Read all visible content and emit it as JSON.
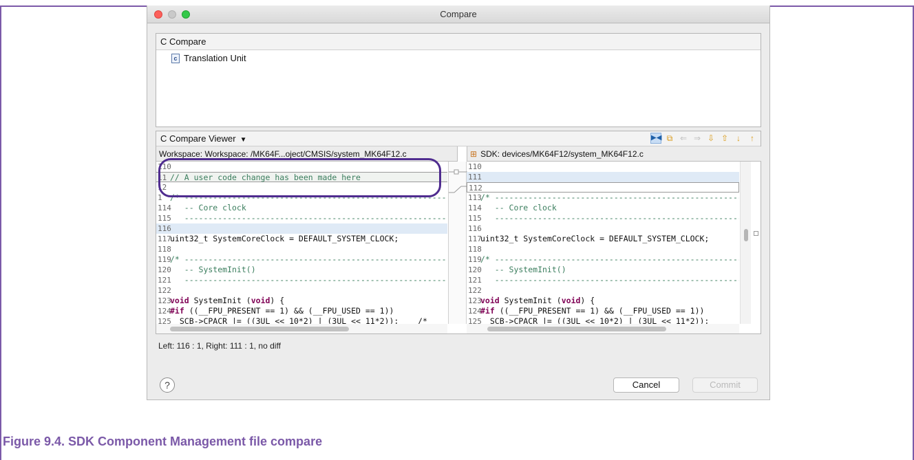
{
  "window": {
    "title": "Compare"
  },
  "structure": {
    "header": "C Compare",
    "item": "Translation Unit",
    "item_icon": "c-file-icon"
  },
  "viewer": {
    "header": "C Compare Viewer",
    "toolbar_icons": [
      "two-way-compare-icon",
      "copy-left-icon",
      "copy-right-icon",
      "copy-all-icon",
      "next-diff-icon",
      "prev-diff-icon",
      "next-change-icon",
      "prev-change-icon"
    ],
    "left_path": "Workspace: Workspace: /MK64F...oject/CMSIS/system_MK64F12.c",
    "right_path": "SDK: devices/MK64F12/system_MK64F12.c",
    "left_lines": [
      {
        "n": "110",
        "t": ""
      },
      {
        "n": "11",
        "t": "// A user code change has been made here"
      },
      {
        "n": "12",
        "t": ""
      },
      {
        "n": "1",
        "t": "/* ------------------------------------------------------------------"
      },
      {
        "n": "114",
        "t": "   -- Core clock"
      },
      {
        "n": "115",
        "t": "   ------------------------------------------------------------------"
      },
      {
        "n": "116",
        "t": ""
      },
      {
        "n": "117",
        "t": "uint32_t SystemCoreClock = DEFAULT_SYSTEM_CLOCK;"
      },
      {
        "n": "118",
        "t": ""
      },
      {
        "n": "119",
        "t": "/* ------------------------------------------------------------------"
      },
      {
        "n": "120",
        "t": "   -- SystemInit()"
      },
      {
        "n": "121",
        "t": "   ------------------------------------------------------------------"
      },
      {
        "n": "122",
        "t": ""
      },
      {
        "n": "123",
        "t": "void SystemInit (void) {"
      },
      {
        "n": "124",
        "t": "#if ((__FPU_PRESENT == 1) && (__FPU_USED == 1))"
      },
      {
        "n": "125",
        "t": "  SCB->CPACR |= ((3UL << 10*2) | (3UL << 11*2));    /*"
      }
    ],
    "right_lines": [
      {
        "n": "110",
        "t": ""
      },
      {
        "n": "111",
        "t": ""
      },
      {
        "n": "112",
        "t": ""
      },
      {
        "n": "113",
        "t": "/* ------------------------------------------------------------------"
      },
      {
        "n": "114",
        "t": "   -- Core clock"
      },
      {
        "n": "115",
        "t": "   ------------------------------------------------------------------"
      },
      {
        "n": "116",
        "t": ""
      },
      {
        "n": "117",
        "t": "uint32_t SystemCoreClock = DEFAULT_SYSTEM_CLOCK;"
      },
      {
        "n": "118",
        "t": ""
      },
      {
        "n": "119",
        "t": "/* ------------------------------------------------------------------"
      },
      {
        "n": "120",
        "t": "   -- SystemInit()"
      },
      {
        "n": "121",
        "t": "   ------------------------------------------------------------------"
      },
      {
        "n": "122",
        "t": ""
      },
      {
        "n": "123",
        "t": "void SystemInit (void) {"
      },
      {
        "n": "124",
        "t": "#if ((__FPU_PRESENT == 1) && (__FPU_USED == 1))"
      },
      {
        "n": "125",
        "t": "  SCB->CPACR |= ((3UL << 10*2) | (3UL << 11*2));"
      }
    ]
  },
  "status": "Left: 116 : 1, Right: 111 : 1, no diff",
  "buttons": {
    "help": "?",
    "cancel": "Cancel",
    "commit": "Commit"
  },
  "caption": "Figure 9.4. SDK Component Management file compare",
  "colors": {
    "accent": "#7b59a8",
    "oval": "#4f2c8f",
    "highlight": "#dfeaf6"
  }
}
